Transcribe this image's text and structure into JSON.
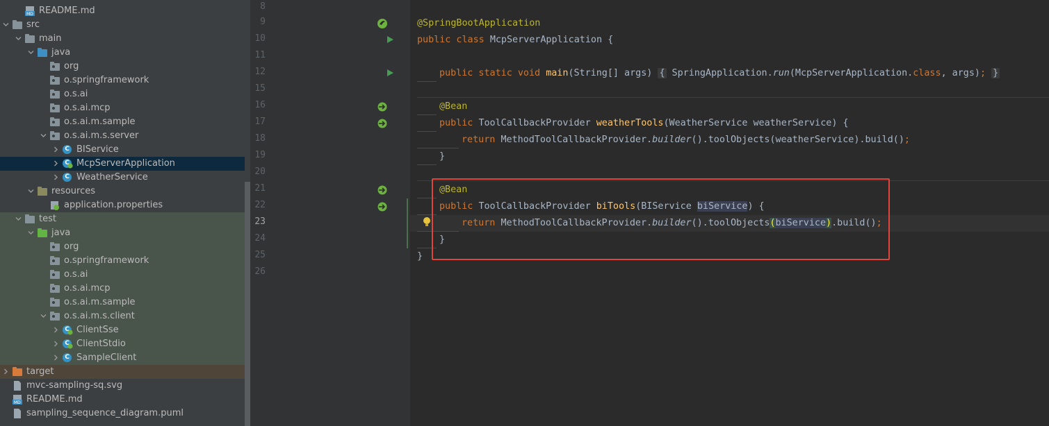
{
  "sidebar": {
    "items": [
      {
        "label": "README.md",
        "icon": "markdown-file-icon",
        "depth": 1,
        "arrow": "none"
      },
      {
        "label": "src",
        "icon": "folder-icon",
        "depth": 0,
        "arrow": "down"
      },
      {
        "label": "main",
        "icon": "folder-icon",
        "depth": 1,
        "arrow": "down"
      },
      {
        "label": "java",
        "icon": "source-folder-icon",
        "depth": 2,
        "arrow": "down"
      },
      {
        "label": "org",
        "icon": "package-icon",
        "depth": 3,
        "arrow": "none"
      },
      {
        "label": "o.springframework",
        "icon": "package-icon",
        "depth": 3,
        "arrow": "none"
      },
      {
        "label": "o.s.ai",
        "icon": "package-icon",
        "depth": 3,
        "arrow": "none"
      },
      {
        "label": "o.s.ai.mcp",
        "icon": "package-icon",
        "depth": 3,
        "arrow": "none"
      },
      {
        "label": "o.s.ai.m.sample",
        "icon": "package-icon",
        "depth": 3,
        "arrow": "none"
      },
      {
        "label": "o.s.ai.m.s.server",
        "icon": "package-icon",
        "depth": 3,
        "arrow": "down"
      },
      {
        "label": "BIService",
        "icon": "class-icon",
        "depth": 4,
        "arrow": "right"
      },
      {
        "label": "McpServerApplication",
        "icon": "spring-class-icon",
        "depth": 4,
        "arrow": "right",
        "selected": true
      },
      {
        "label": "WeatherService",
        "icon": "class-icon",
        "depth": 4,
        "arrow": "right"
      },
      {
        "label": "resources",
        "icon": "resources-folder-icon",
        "depth": 2,
        "arrow": "down"
      },
      {
        "label": "application.properties",
        "icon": "properties-file-icon",
        "depth": 3,
        "arrow": "none"
      },
      {
        "label": "test",
        "icon": "folder-icon",
        "depth": 1,
        "arrow": "down",
        "test": true
      },
      {
        "label": "java",
        "icon": "test-source-folder-icon",
        "depth": 2,
        "arrow": "down",
        "test": true
      },
      {
        "label": "org",
        "icon": "package-icon",
        "depth": 3,
        "arrow": "none",
        "test": true
      },
      {
        "label": "o.springframework",
        "icon": "package-icon",
        "depth": 3,
        "arrow": "none",
        "test": true
      },
      {
        "label": "o.s.ai",
        "icon": "package-icon",
        "depth": 3,
        "arrow": "none",
        "test": true
      },
      {
        "label": "o.s.ai.mcp",
        "icon": "package-icon",
        "depth": 3,
        "arrow": "none",
        "test": true
      },
      {
        "label": "o.s.ai.m.sample",
        "icon": "package-icon",
        "depth": 3,
        "arrow": "none",
        "test": true
      },
      {
        "label": "o.s.ai.m.s.client",
        "icon": "package-icon",
        "depth": 3,
        "arrow": "down",
        "test": true
      },
      {
        "label": "ClientSse",
        "icon": "spring-class-icon",
        "depth": 4,
        "arrow": "right",
        "test": true
      },
      {
        "label": "ClientStdio",
        "icon": "spring-class-icon",
        "depth": 4,
        "arrow": "right",
        "test": true
      },
      {
        "label": "SampleClient",
        "icon": "class-icon",
        "depth": 4,
        "arrow": "right",
        "test": true
      },
      {
        "label": "target",
        "icon": "excluded-folder-icon",
        "depth": 0,
        "arrow": "right",
        "target": true
      },
      {
        "label": "mvc-sampling-sq.svg",
        "icon": "svg-file-icon",
        "depth": 0,
        "arrow": "none"
      },
      {
        "label": "README.md",
        "icon": "markdown-file-icon",
        "depth": 0,
        "arrow": "none"
      },
      {
        "label": "sampling_sequence_diagram.puml",
        "icon": "puml-file-icon",
        "depth": 0,
        "arrow": "none"
      }
    ]
  },
  "editor": {
    "lines": [
      {
        "num": "8"
      },
      {
        "num": "9"
      },
      {
        "num": "10"
      },
      {
        "num": "11"
      },
      {
        "num": "12"
      },
      {
        "num": "15"
      },
      {
        "num": "16"
      },
      {
        "num": "17"
      },
      {
        "num": "18"
      },
      {
        "num": "19"
      },
      {
        "num": "20"
      },
      {
        "num": "21"
      },
      {
        "num": "22"
      },
      {
        "num": "23"
      },
      {
        "num": "24"
      },
      {
        "num": "25"
      },
      {
        "num": "26"
      }
    ],
    "code": {
      "ann1": "@SpringBootApplication",
      "l10_kw": "public class ",
      "l10_rest": "McpServerApplication {",
      "l12_kw": "public static void ",
      "l12_fn": "main",
      "l12_args": "(String[] args) ",
      "l12_open": "{",
      "l12_body1": " SpringApplication.",
      "l12_run": "run",
      "l12_body2": "(McpServerApplication.",
      "l12_class": "class",
      "l12_body3": ", args)",
      "l12_semi": ";",
      "l12_close": "}",
      "bean": "@Bean",
      "l17_kw": "public ",
      "l17_type": "ToolCallbackProvider ",
      "l17_fn": "weatherTools",
      "l17_rest": "(WeatherService weatherService) {",
      "l18_kw": "return ",
      "l18_a": "MethodToolCallbackProvider.",
      "l18_b": "builder",
      "l18_c": "().toolObjects(weatherService).build()",
      "semi": ";",
      "close": "}",
      "l22_kw": "public ",
      "l22_type": "ToolCallbackProvider ",
      "l22_fn": "biTools",
      "l22_a": "(BIService ",
      "l22_param": "biService",
      "l22_b": ") {",
      "l23_kw": "return ",
      "l23_a": "MethodToolCallbackProvider.",
      "l23_b": "builder",
      "l23_c": "().toolObjects",
      "l23_open": "(",
      "l23_var": "biService",
      "l23_close": ")",
      "l23_d": ".build()"
    }
  }
}
